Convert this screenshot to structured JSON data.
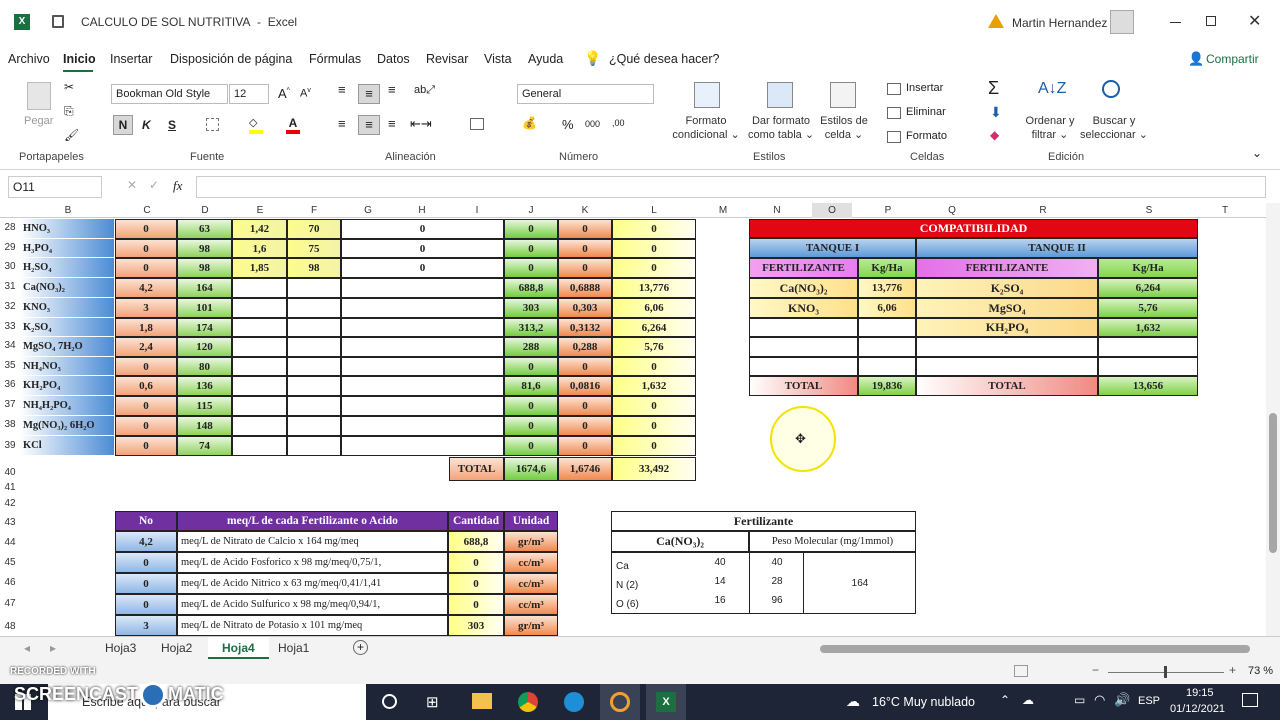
{
  "title": {
    "doc": "CALCULO DE SOL NUTRITIVA",
    "sep": "-",
    "app": "Excel",
    "user": "Martin Hernandez"
  },
  "menu": [
    "Archivo",
    "Inicio",
    "Insertar",
    "Disposición de página",
    "Fórmulas",
    "Datos",
    "Revisar",
    "Vista",
    "Ayuda"
  ],
  "tell": "¿Qué desea hacer?",
  "share": "Compartir",
  "ribbon": {
    "paste": "Pegar",
    "font": "Bookman Old Style",
    "size": "12",
    "bold": "N",
    "italic": "K",
    "underline": "S",
    "numfmt": "General",
    "fmt_cond": [
      "Formato",
      "condicional ⌄"
    ],
    "fmt_table": [
      "Dar formato",
      "como tabla ⌄"
    ],
    "styles": [
      "Estilos de",
      "celda ⌄"
    ],
    "insert": "Insertar",
    "delete": "Eliminar",
    "format": "Formato",
    "sort": [
      "Ordenar y",
      "filtrar ⌄"
    ],
    "find": [
      "Buscar y",
      "seleccionar ⌄"
    ],
    "groups": [
      "Portapapeles",
      "Fuente",
      "Alineación",
      "Número",
      "Estilos",
      "Celdas",
      "Edición"
    ]
  },
  "namebox": "O11",
  "fx": "fx",
  "cols": [
    "B",
    "C",
    "D",
    "E",
    "F",
    "G",
    "H",
    "I",
    "J",
    "K",
    "L",
    "M",
    "N",
    "O",
    "P",
    "Q",
    "R",
    "S",
    "T"
  ],
  "rows": [
    "28",
    "29",
    "30",
    "31",
    "32",
    "33",
    "34",
    "35",
    "36",
    "37",
    "38",
    "39",
    "40",
    "41",
    "42",
    "43",
    "44",
    "45",
    "46",
    "47",
    "48"
  ],
  "table": [
    {
      "n": "HNO₃",
      "c": "0",
      "d": "63",
      "e": "1,42",
      "f": "70",
      "h": "0",
      "j": "0",
      "k": "0",
      "l": "0"
    },
    {
      "n": "H₃PO₄",
      "c": "0",
      "d": "98",
      "e": "1,6",
      "f": "75",
      "h": "0",
      "j": "0",
      "k": "0",
      "l": "0"
    },
    {
      "n": "H₂SO₄",
      "c": "0",
      "d": "98",
      "e": "1,85",
      "f": "98",
      "h": "0",
      "j": "0",
      "k": "0",
      "l": "0"
    },
    {
      "n": "Ca(NO₃)₂",
      "c": "4,2",
      "d": "164",
      "e": "",
      "f": "",
      "h": "",
      "j": "688,8",
      "k": "0,6888",
      "l": "13,776"
    },
    {
      "n": "KNO₃",
      "c": "3",
      "d": "101",
      "e": "",
      "f": "",
      "h": "",
      "j": "303",
      "k": "0,303",
      "l": "6,06"
    },
    {
      "n": "K₂SO₄",
      "c": "1,8",
      "d": "174",
      "e": "",
      "f": "",
      "h": "",
      "j": "313,2",
      "k": "0,3132",
      "l": "6,264"
    },
    {
      "n": "MgSO₄ 7H₂O",
      "c": "2,4",
      "d": "120",
      "e": "",
      "f": "",
      "h": "",
      "j": "288",
      "k": "0,288",
      "l": "5,76"
    },
    {
      "n": "NH₄NO₃",
      "c": "0",
      "d": "80",
      "e": "",
      "f": "",
      "h": "",
      "j": "0",
      "k": "0",
      "l": "0"
    },
    {
      "n": "KH₂PO₄",
      "c": "0,6",
      "d": "136",
      "e": "",
      "f": "",
      "h": "",
      "j": "81,6",
      "k": "0,0816",
      "l": "1,632"
    },
    {
      "n": "NH₄H₂PO₄",
      "c": "0",
      "d": "115",
      "e": "",
      "f": "",
      "h": "",
      "j": "0",
      "k": "0",
      "l": "0"
    },
    {
      "n": "Mg(NO₃)₂ 6H₂O",
      "c": "0",
      "d": "148",
      "e": "",
      "f": "",
      "h": "",
      "j": "0",
      "k": "0",
      "l": "0"
    },
    {
      "n": "KCl",
      "c": "0",
      "d": "74",
      "e": "",
      "f": "",
      "h": "",
      "j": "0",
      "k": "0",
      "l": "0"
    }
  ],
  "total": {
    "label": "TOTAL",
    "j": "1674,6",
    "k": "1,6746",
    "l": "33,492"
  },
  "compat": {
    "title": "COMPATIBILIDAD",
    "t1": "TANQUE I",
    "t2": "TANQUE II",
    "fert": "FERTILIZANTE",
    "kgha": "Kg/Ha",
    "t1rows": [
      {
        "n": "Ca(NO₃)₂",
        "v": "13,776"
      },
      {
        "n": "KNO₃",
        "v": "6,06"
      }
    ],
    "t2rows": [
      {
        "n": "K₂SO₄",
        "v": "6,264"
      },
      {
        "n": "MgSO₄",
        "v": "5,76"
      },
      {
        "n": "KH₂PO₄",
        "v": "1,632"
      }
    ],
    "total": "TOTAL",
    "tot1": "19,836",
    "tot2": "13,656"
  },
  "meq": {
    "h": [
      "No",
      "meq/L de cada Fertilizante o Acido",
      "Cantidad",
      "Unidad"
    ],
    "rows": [
      {
        "no": "4,2",
        "d": "meq/L de Nitrato de Calcio  x 164 mg/meq",
        "q": "688,8",
        "u": "gr/m³"
      },
      {
        "no": "0",
        "d": "meq/L de Acido Fosforico  x 98 mg/meq/0,75/1,",
        "q": "0",
        "u": "cc/m³"
      },
      {
        "no": "0",
        "d": "meq/L de Acido Nitrico x 63 mg/meq/0,41/1,41",
        "q": "0",
        "u": "cc/m³"
      },
      {
        "no": "0",
        "d": "meq/L de Acido Sulfurico  x 98 mg/meq/0,94/1,",
        "q": "0",
        "u": "cc/m³"
      },
      {
        "no": "3",
        "d": "meq/L de Nitrato de Potasio x 101 mg/meq",
        "q": "303",
        "u": "gr/m³"
      }
    ]
  },
  "fert": {
    "title": "Fertilizante",
    "name": "Ca(NO₃)₂",
    "pm": "Peso Molecular (mg/1mmol)",
    "pmv": "164",
    "rows": [
      {
        "e": "Ca",
        "a": "40",
        "b": "40"
      },
      {
        "e": "N (2)",
        "a": "14",
        "b": "28"
      },
      {
        "e": "O (6)",
        "a": "16",
        "b": "96"
      }
    ]
  },
  "sheets": [
    "Hoja3",
    "Hoja2",
    "Hoja4",
    "Hoja1"
  ],
  "zoom": "73 %",
  "watermark": {
    "top": "RECORDED WITH",
    "brand": "SCREENCAST",
    "brand2": "MATIC"
  },
  "task": {
    "search": "Escribe aquí para buscar",
    "weather": "16°C  Muy nublado",
    "lang": "ESP",
    "time": "19:15",
    "date": "01/12/2021"
  }
}
